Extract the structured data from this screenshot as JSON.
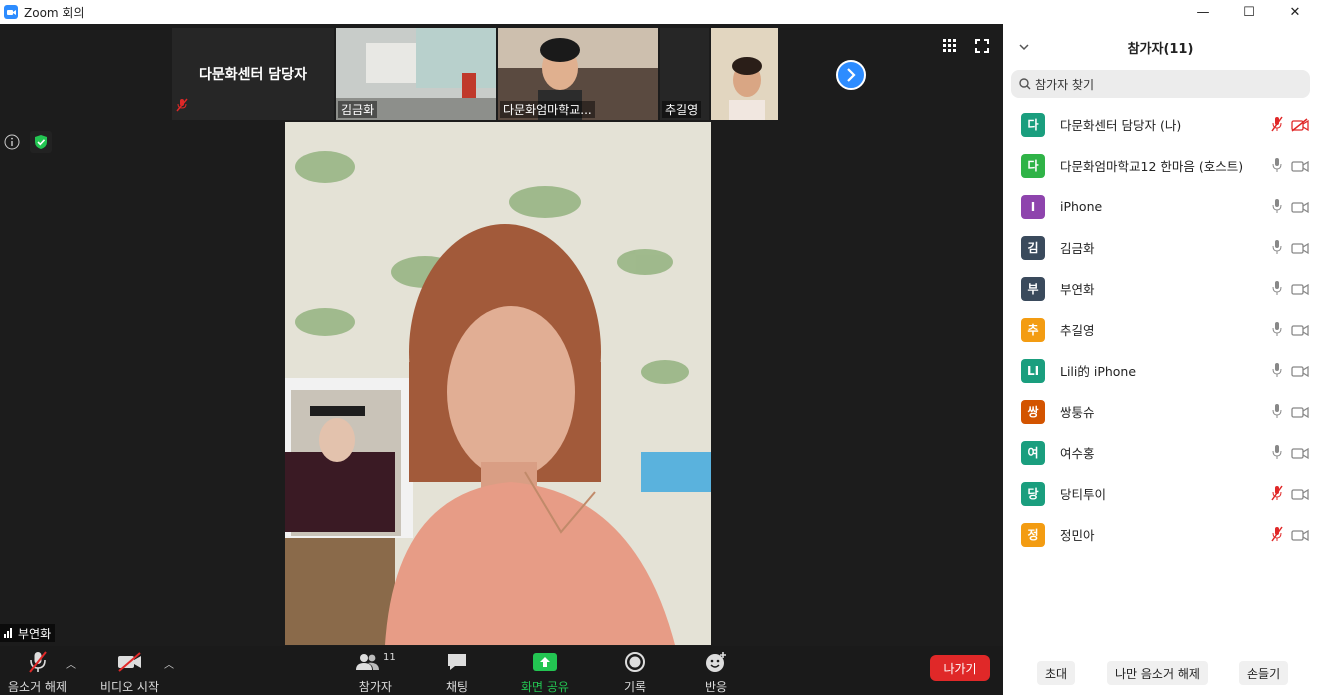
{
  "window": {
    "title": "Zoom 회의"
  },
  "strip": {
    "host_tile_name": "다문화센터 담당자",
    "tiles": [
      {
        "label": "김금화"
      },
      {
        "label": "다문화엄마학교..."
      },
      {
        "label": "추길영"
      }
    ]
  },
  "speaker": {
    "name": "부연화"
  },
  "toolbar": {
    "unmute_label": "음소거 해제",
    "video_label": "비디오 시작",
    "participants_label": "참가자",
    "participants_count": "11",
    "chat_label": "채팅",
    "share_label": "화면 공유",
    "record_label": "기록",
    "reactions_label": "반응",
    "leave_label": "나가기"
  },
  "panel": {
    "title": "참가자(11)",
    "search_placeholder": "참가자 찾기",
    "participants": [
      {
        "initial": "다",
        "name": "다문화센터 담당자 (나)",
        "color": "#1a9e7e",
        "mic_muted": true,
        "cam_off": true
      },
      {
        "initial": "다",
        "name": "다문화엄마학교12 한마음 (호스트)",
        "color": "#2fb347",
        "mic_muted": false,
        "cam_off": false
      },
      {
        "initial": "I",
        "name": "iPhone",
        "color": "#8e44ad",
        "mic_muted": false,
        "cam_off": false
      },
      {
        "initial": "김",
        "name": "김금화",
        "color": "#3a4a5c",
        "mic_muted": false,
        "cam_off": false
      },
      {
        "initial": "부",
        "name": "부연화",
        "color": "#3a4a5c",
        "mic_muted": false,
        "cam_off": false
      },
      {
        "initial": "추",
        "name": "추길영",
        "color": "#f39c12",
        "mic_muted": false,
        "cam_off": false
      },
      {
        "initial": "LI",
        "name": "Lili的 iPhone",
        "color": "#1a9e7e",
        "mic_muted": false,
        "cam_off": false
      },
      {
        "initial": "쌍",
        "name": "쌍퉁슈",
        "color": "#d35400",
        "mic_muted": false,
        "cam_off": false
      },
      {
        "initial": "여",
        "name": "여수홍",
        "color": "#1a9e7e",
        "mic_muted": false,
        "cam_off": false
      },
      {
        "initial": "당",
        "name": "당티투이",
        "color": "#1a9e7e",
        "mic_muted": true,
        "cam_off": false
      },
      {
        "initial": "정",
        "name": "정민아",
        "color": "#f39c12",
        "mic_muted": true,
        "cam_off": false
      }
    ],
    "invite_label": "초대",
    "unmute_me_label": "나만 음소거 해제",
    "raise_hand_label": "손들기"
  }
}
